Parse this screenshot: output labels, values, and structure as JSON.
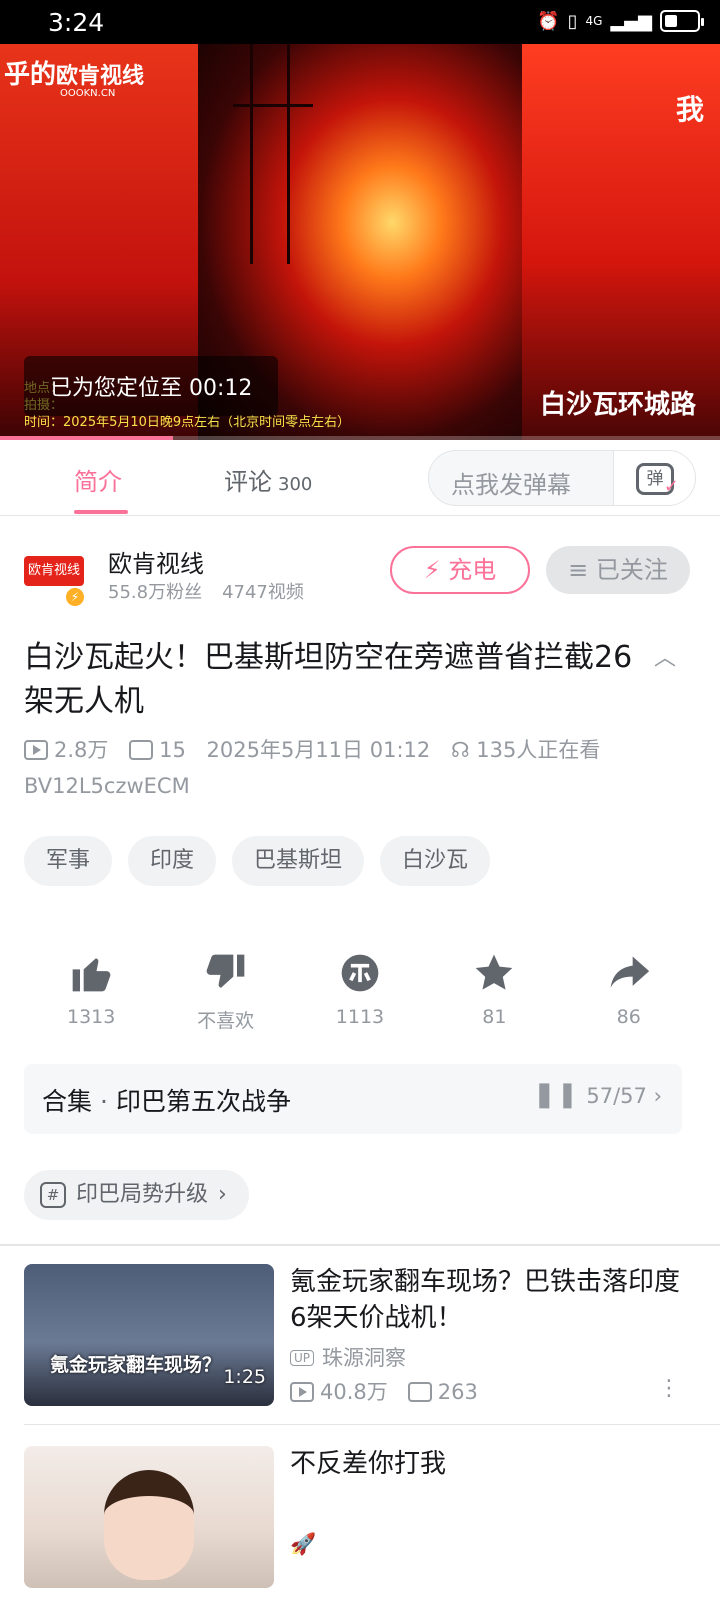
{
  "status_bar": {
    "time": "3:24",
    "network": "4G"
  },
  "video": {
    "watermark": "乎的",
    "watermark_channel": "欧肯视线",
    "watermark_site": "OOOKN.CN",
    "right_text": "我",
    "toast": "已为您定位至 00:12",
    "caption_lines": [
      "地点：",
      "拍摄：",
      "时间：2025年5月10日晚9点左右（北京时间零点左右）"
    ],
    "street_label": "白沙瓦环城路",
    "progress_percent": 24
  },
  "tabs": {
    "intro": "简介",
    "comments": "评论",
    "comments_count": "300",
    "danmaku_placeholder": "点我发弹幕",
    "danmaku_icon_char": "弹"
  },
  "uploader": {
    "name": "欧肯视线",
    "avatar_text": "欧肯视线",
    "fans": "55.8万粉丝",
    "videos": "4747视频",
    "charge_label": "充电",
    "follow_label": "已关注"
  },
  "video_info": {
    "title": "白沙瓦起火！巴基斯坦防空在旁遮普省拦截26架无人机",
    "views": "2.8万",
    "danmaku": "15",
    "date": "2025年5月11日 01:12",
    "watching": "135人正在看",
    "bvid": "BV12L5czwECM"
  },
  "tags": [
    "军事",
    "印度",
    "巴基斯坦",
    "白沙瓦"
  ],
  "actions": {
    "like": "1313",
    "dislike": "不喜欢",
    "coin": "1113",
    "favorite": "81",
    "share": "86"
  },
  "collection": {
    "label": "合集",
    "name": "印巴第五次战争",
    "count": "57/57"
  },
  "topic": {
    "label": "印巴局势升级"
  },
  "recommendations": [
    {
      "title": "氪金玩家翻车现场？巴铁击落印度6架天价战机！",
      "thumb_text": "氪金玩家翻车现场？",
      "duration": "1:25",
      "uploader": "珠源洞察",
      "views": "40.8万",
      "danmaku": "263"
    },
    {
      "title": "不反差你打我",
      "uploader": "",
      "views": "",
      "danmaku": ""
    }
  ],
  "colors": {
    "accent": "#fb7299",
    "text": "#18191c",
    "muted": "#9499a0"
  }
}
